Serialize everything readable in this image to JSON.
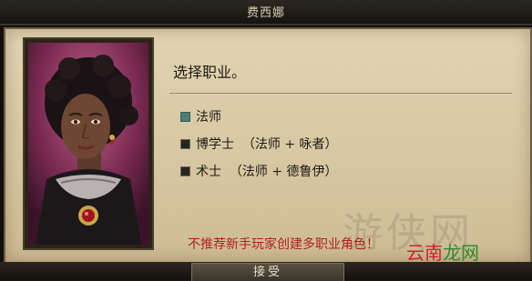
{
  "window": {
    "title": "费西娜"
  },
  "prompt": {
    "heading": "选择职业。"
  },
  "options": [
    {
      "label": "法师",
      "selected": true
    },
    {
      "label": "博学士  （法师 + 咏者）",
      "selected": false
    },
    {
      "label": "术士  （法师 + 德鲁伊）",
      "selected": false
    }
  ],
  "warning": "不推荐新手玩家创建多职业角色！",
  "footer": {
    "accept_label": "接受"
  },
  "watermark": {
    "text": "游侠网"
  },
  "logo": {
    "part1": "云南",
    "part2": "龙网"
  },
  "colors": {
    "panel_bg": "#d6c6a1",
    "warning_text": "#b2221c",
    "selected_box": "#4e7f76"
  }
}
